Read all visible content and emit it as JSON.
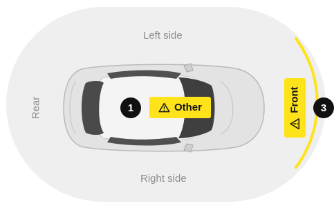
{
  "zones": {
    "left_side": "Left side",
    "right_side": "Right side",
    "rear": "Rear"
  },
  "markers": [
    {
      "number": "1",
      "label": "Other",
      "icon": "warning-triangle-icon"
    },
    {
      "number": "3",
      "label": "Front",
      "icon": "warning-triangle-icon"
    }
  ],
  "colors": {
    "zone_background": "#efefef",
    "highlight": "#ffe31a",
    "badge": "#111111",
    "car_body": "#dcdcdc"
  }
}
